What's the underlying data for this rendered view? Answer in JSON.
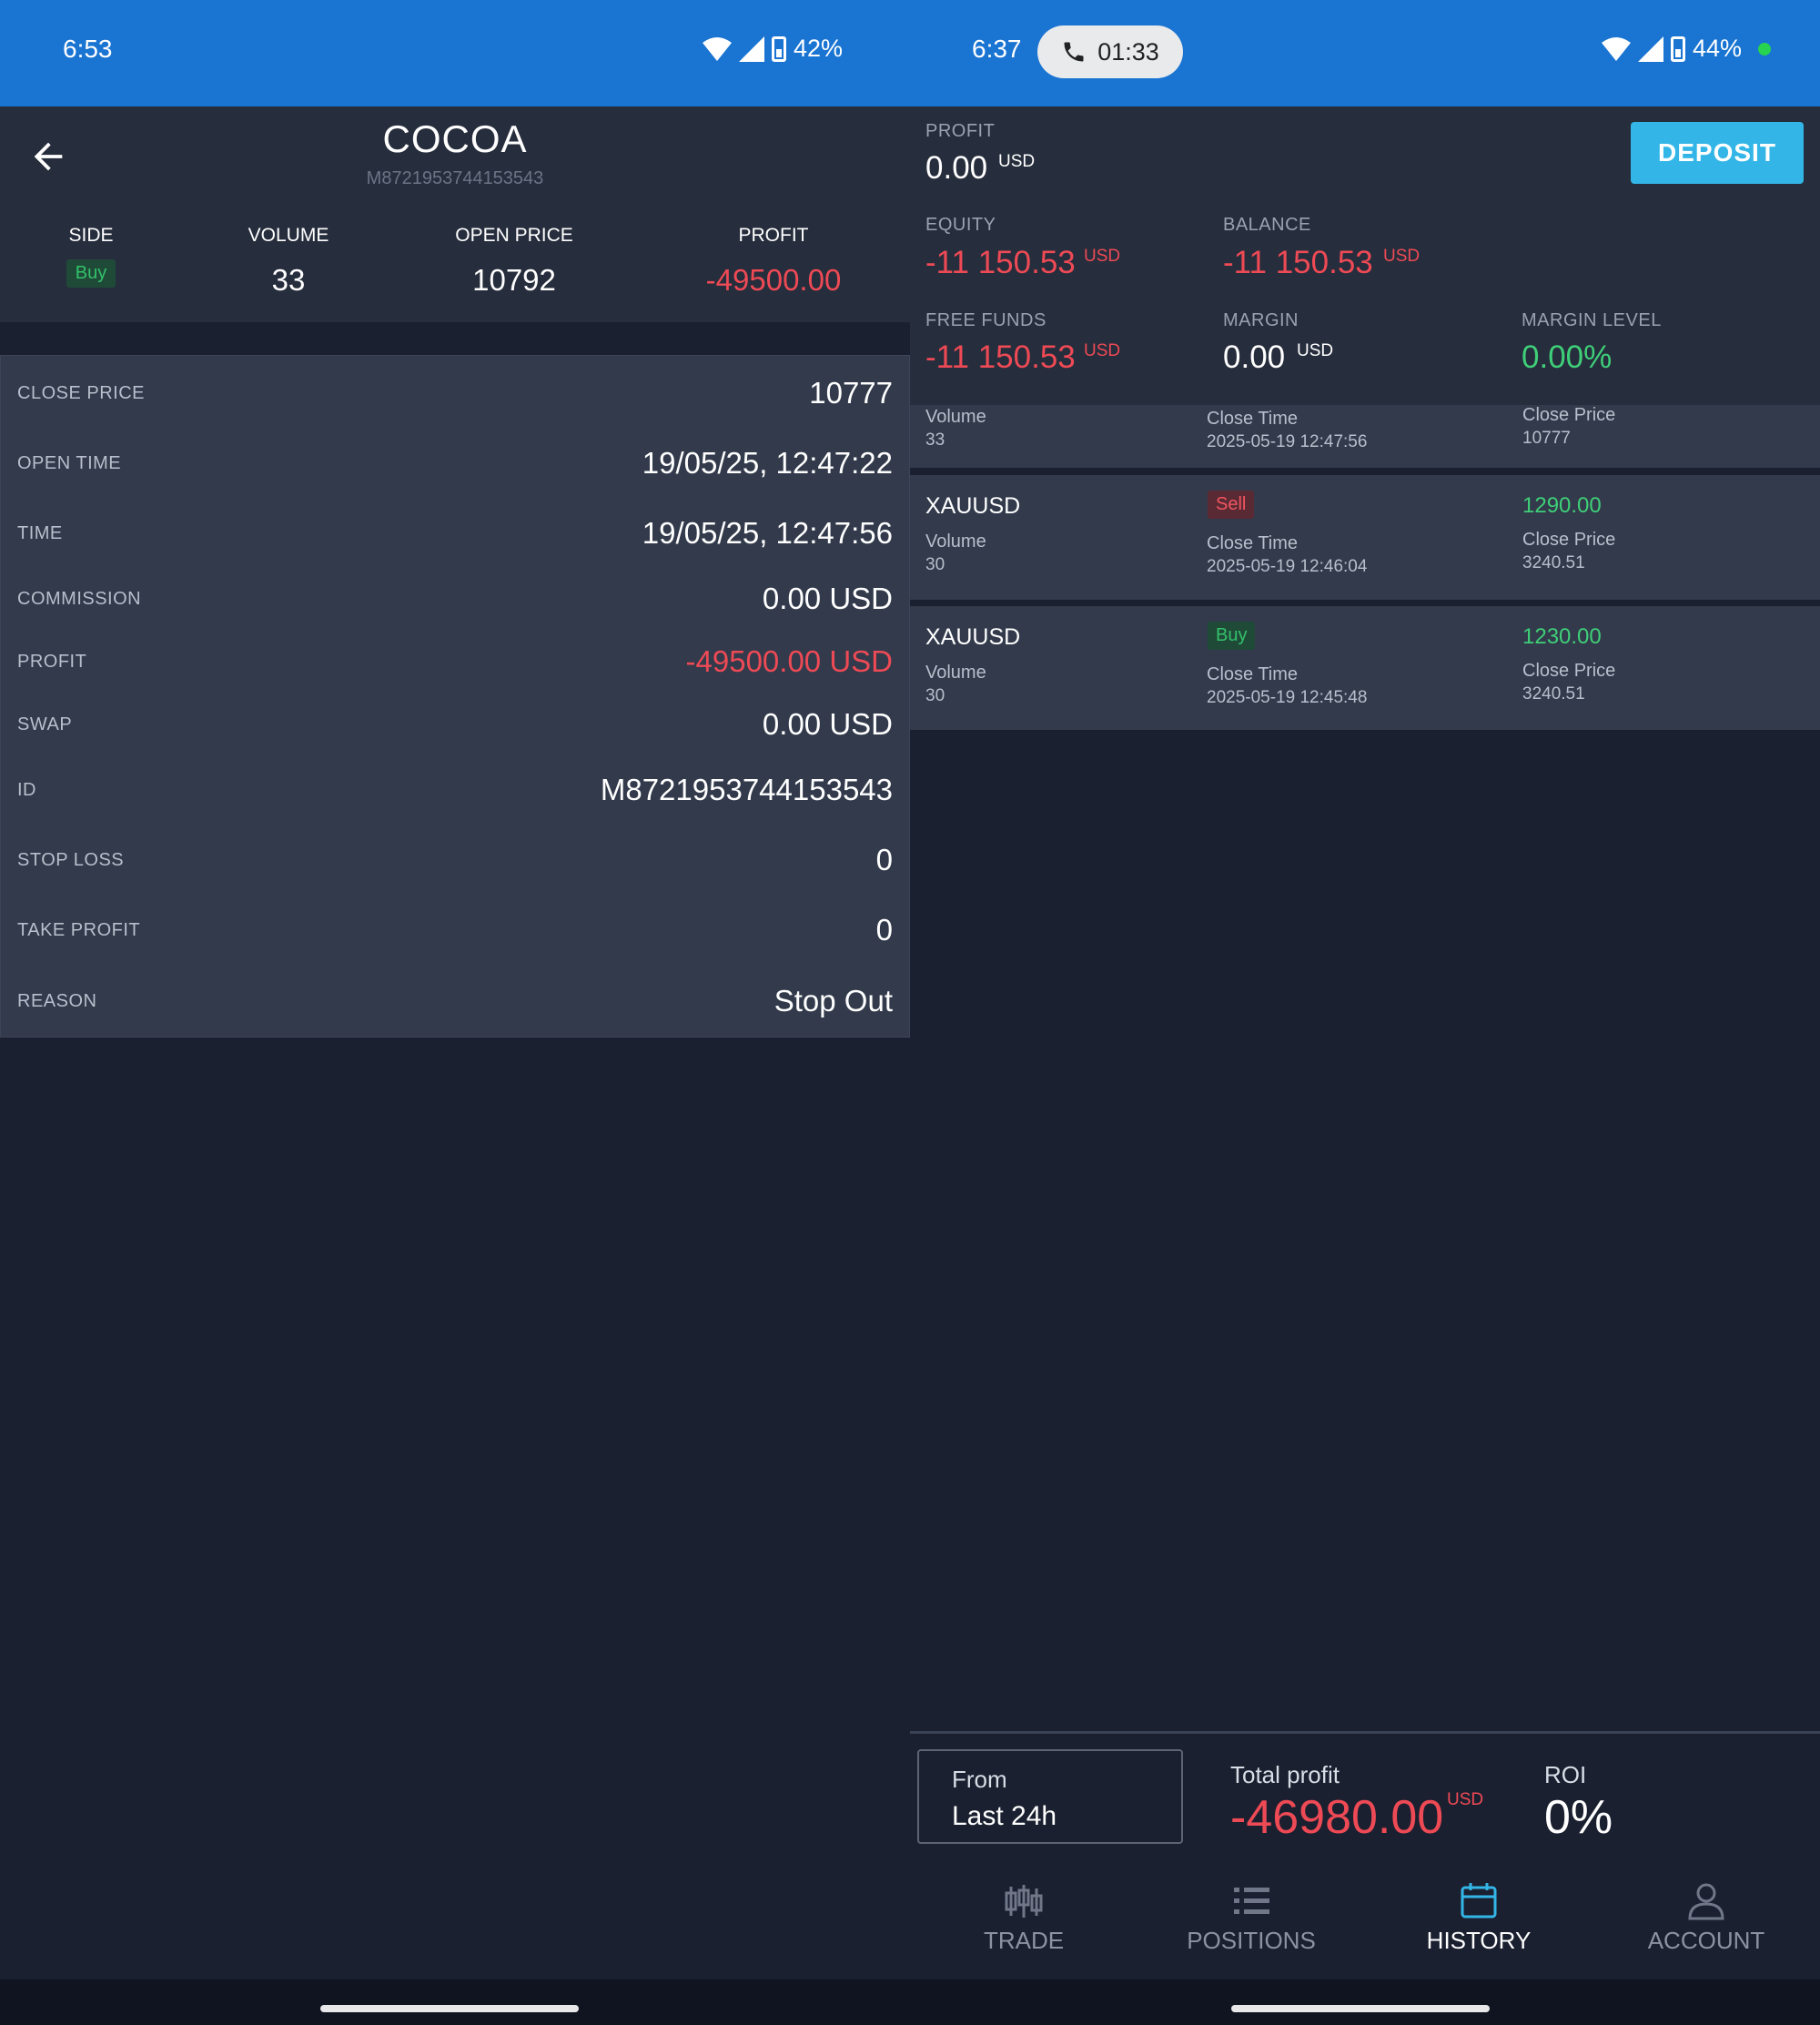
{
  "left_status": {
    "time": "6:53",
    "battery": "42%"
  },
  "right_status": {
    "time": "6:37",
    "call_timer": "01:33",
    "battery": "44%"
  },
  "detail": {
    "title": "COCOA",
    "subtitle_id": "M8721953744153543",
    "stats": {
      "side_label": "SIDE",
      "side_value": "Buy",
      "volume_label": "VOLUME",
      "volume_value": "33",
      "open_price_label": "OPEN PRICE",
      "open_price_value": "10792",
      "profit_label": "PROFIT",
      "profit_value": "-49500.00"
    },
    "rows": [
      {
        "key": "CLOSE PRICE",
        "value": "10777"
      },
      {
        "key": "OPEN TIME",
        "value": "19/05/25, 12:47:22"
      },
      {
        "key": "TIME",
        "value": "19/05/25, 12:47:56"
      },
      {
        "key": "COMMISSION",
        "value": "0.00 USD"
      },
      {
        "key": "PROFIT",
        "value": "-49500.00 USD"
      },
      {
        "key": "SWAP",
        "value": "0.00 USD"
      },
      {
        "key": "ID",
        "value": "M8721953744153543"
      },
      {
        "key": "STOP LOSS",
        "value": "0"
      },
      {
        "key": "TAKE PROFIT",
        "value": "0"
      },
      {
        "key": "REASON",
        "value": "Stop Out"
      }
    ]
  },
  "account": {
    "profit_label": "PROFIT",
    "profit_value": "0.00",
    "profit_cur": "USD",
    "deposit_label": "DEPOSIT",
    "equity_label": "EQUITY",
    "equity_value": "-11 150.53",
    "equity_cur": "USD",
    "balance_label": "BALANCE",
    "balance_value": "-11 150.53",
    "balance_cur": "USD",
    "free_funds_label": "FREE FUNDS",
    "free_funds_value": "-11 150.53",
    "free_funds_cur": "USD",
    "margin_label": "MARGIN",
    "margin_value": "0.00",
    "margin_cur": "USD",
    "margin_level_label": "MARGIN LEVEL",
    "margin_level_value": "0.00%"
  },
  "history": {
    "partial_row": {
      "volume_label": "Volume",
      "volume": "33",
      "close_time_label": "Close Time",
      "close_time": "2025-05-19 12:47:56",
      "close_price_label": "Close Price",
      "close_price": "10777"
    },
    "rows": [
      {
        "symbol": "XAUUSD",
        "side": "Sell",
        "pnl": "1290.00",
        "volume_label": "Volume",
        "volume": "30",
        "close_time_label": "Close Time",
        "close_time": "2025-05-19 12:46:04",
        "close_price_label": "Close Price",
        "close_price": "3240.51"
      },
      {
        "symbol": "XAUUSD",
        "side": "Buy",
        "pnl": "1230.00",
        "volume_label": "Volume",
        "volume": "30",
        "close_time_label": "Close Time",
        "close_time": "2025-05-19 12:45:48",
        "close_price_label": "Close Price",
        "close_price": "3240.51"
      }
    ]
  },
  "summary": {
    "from_label": "From",
    "from_value": "Last 24h",
    "total_profit_label": "Total profit",
    "total_profit_value": "-46980.00",
    "total_profit_cur": "USD",
    "roi_label": "ROI",
    "roi_value": "0%"
  },
  "nav": {
    "items": [
      {
        "label": "TRADE",
        "icon": "candlestick-icon",
        "active": false
      },
      {
        "label": "POSITIONS",
        "icon": "list-icon",
        "active": false
      },
      {
        "label": "HISTORY",
        "icon": "calendar-icon",
        "active": true
      },
      {
        "label": "ACCOUNT",
        "icon": "user-icon",
        "active": false
      }
    ]
  },
  "colors": {
    "status_bar": "#1a74d2",
    "negative": "#ee4a55",
    "positive": "#3fcf78",
    "accent": "#33b6e7",
    "background": "#1b2030"
  }
}
